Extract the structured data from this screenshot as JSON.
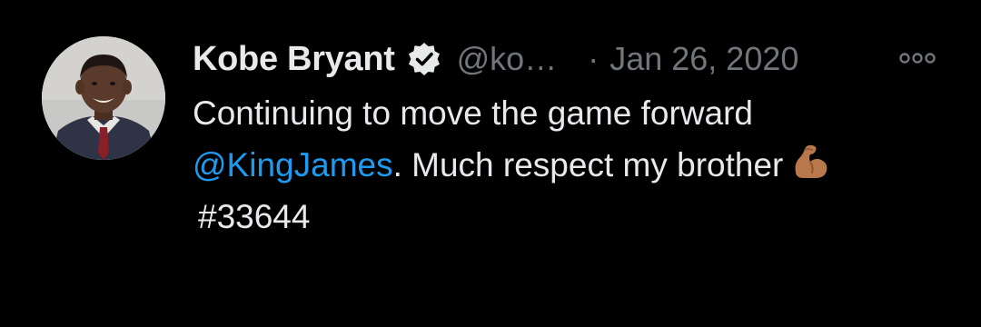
{
  "tweet": {
    "author_name": "Kobe Bryant",
    "handle": "@ko…",
    "separator": "·",
    "date": "Jan 26, 2020",
    "text_line1": "Continuing to move the game forward",
    "mention": "@KingJames",
    "text_line2_rest": ". Much respect my brother",
    "hashtag": "#33644",
    "emoji": "flexed-biceps-emoji",
    "verified_icon": "verified-badge-icon",
    "more_icon": "more-options-icon"
  },
  "colors": {
    "background": "#000000",
    "text": "#e7e9ea",
    "secondary": "#71767b",
    "link": "#1d9bf0"
  }
}
